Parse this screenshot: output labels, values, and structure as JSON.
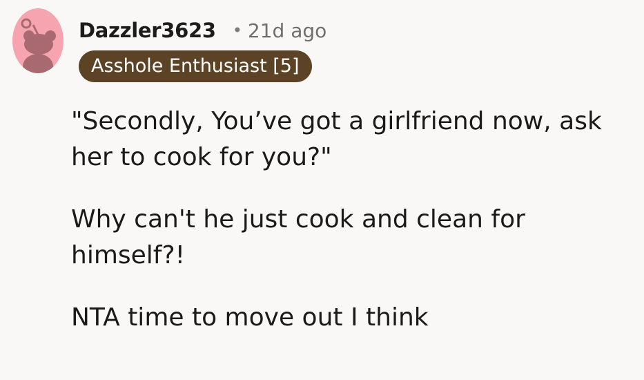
{
  "comment": {
    "username": "Dazzler3623",
    "separator": "•",
    "timestamp": "21d ago",
    "flair": "Asshole Enthusiast [5]",
    "paragraphs": [
      "\"Secondly, You’ve got a girlfriend now, ask her to cook for you?\"",
      "Why can't he just cook and clean for himself?!",
      "NTA time to move out I think"
    ]
  },
  "avatar": {
    "icon": "snoo-avatar-icon",
    "background_color": "#f6a5b0",
    "figure_color": "#a96970"
  },
  "colors": {
    "flair_background": "#5c4326",
    "flair_text": "#ffffff",
    "page_background": "#faf8f6"
  }
}
